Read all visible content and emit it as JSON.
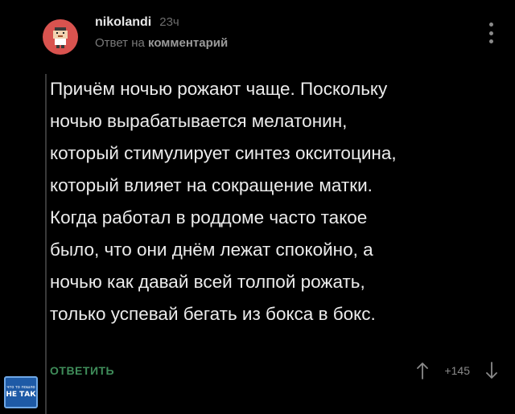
{
  "comment": {
    "author": "nikolandi",
    "time": "23ч",
    "reply_prefix": "Ответ на",
    "reply_target": "комментарий",
    "avatar_icon": "pixel-character-avatar",
    "menu_icon": "kebab-menu-icon",
    "text": "Причём ночью рожают чаще. Поскольку\nночью вырабатывается мелатонин,\nкоторый стимулирует синтез окситоцина,\nкоторый влияет на сокращение матки.\nКогда работал в роддоме часто такое\nбыло, что они днём лежат спокойно, а\nночью как давай всей толпой рожать,\nтолько успевай бегать из бокса в бокс."
  },
  "actions": {
    "reply_label": "ОТВЕТИТЬ",
    "rating": "+145",
    "upvote_icon": "arrow-up-icon",
    "downvote_icon": "arrow-down-icon"
  },
  "watermark": {
    "top_text": "что то пошло",
    "main_text": "НЕ ТАК"
  },
  "colors": {
    "background": "#000000",
    "text": "#ececec",
    "muted": "#7a7a7a",
    "reply_accent": "#3f8d5a",
    "avatar_bg": "#d9534f"
  }
}
